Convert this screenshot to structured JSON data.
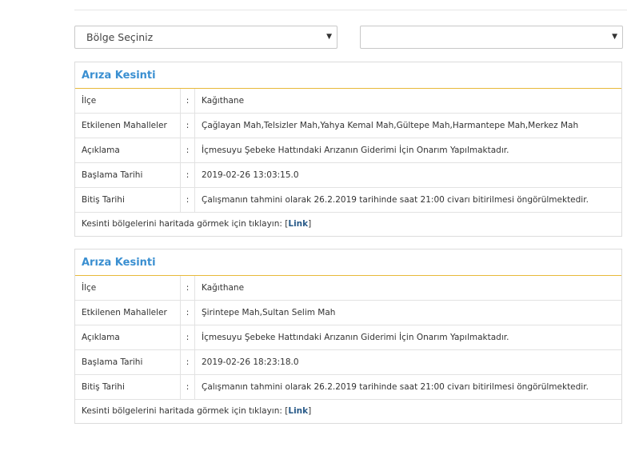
{
  "filters": {
    "region_select": {
      "value": "Bölge Seçiniz",
      "arrow": "▼"
    },
    "second_select": {
      "value": "",
      "arrow": "▼"
    }
  },
  "labels": {
    "ilce": "İlçe",
    "mahalleler": "Etkilenen Mahalleler",
    "aciklama": "Açıklama",
    "baslama": "Başlama Tarihi",
    "bitis": "Bitiş Tarihi",
    "separator": ":",
    "footer_text": "Kesinti bölgelerini haritada görmek için tıklayın: ",
    "link_open": "[",
    "link_text": "Link",
    "link_close": "]"
  },
  "outages": [
    {
      "title": "Arıza Kesinti",
      "ilce": "Kağıthane",
      "mahalleler": "Çağlayan Mah,Telsizler Mah,Yahya Kemal Mah,Gültepe Mah,Harmantepe Mah,Merkez Mah",
      "aciklama": "İçmesuyu Şebeke Hattındaki Arızanın Giderimi İçin Onarım Yapılmaktadır.",
      "baslama": "2019-02-26 13:03:15.0",
      "bitis": "Çalışmanın tahmini olarak 26.2.2019 tarihinde saat 21:00 civarı bitirilmesi öngörülmektedir."
    },
    {
      "title": "Arıza Kesinti",
      "ilce": "Kağıthane",
      "mahalleler": "Şirintepe Mah,Sultan Selim Mah",
      "aciklama": "İçmesuyu Şebeke Hattındaki Arızanın Giderimi İçin Onarım Yapılmaktadır.",
      "baslama": "2019-02-26 18:23:18.0",
      "bitis": "Çalışmanın tahmini olarak 26.2.2019 tarihinde saat 21:00 civarı bitirilmesi öngörülmektedir."
    }
  ]
}
